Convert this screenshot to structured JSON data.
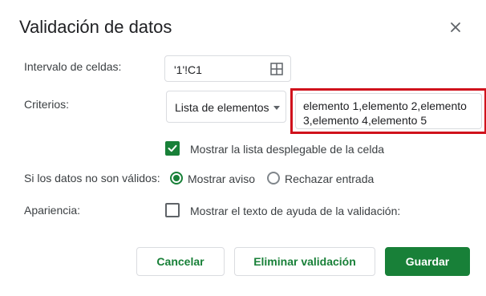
{
  "dialog": {
    "title": "Validación de datos",
    "close_icon": "close-icon"
  },
  "range": {
    "label": "Intervalo de celdas:",
    "value": "'1'!C1",
    "icon": "grid-icon"
  },
  "criteria": {
    "label": "Criterios:",
    "type_selected": "Lista de elementos",
    "items_value": "elemento 1,elemento 2,elemento 3,elemento 4,elemento 5",
    "highlight_color": "#d0121c"
  },
  "dropdown_option": {
    "checked": true,
    "label": "Mostrar la lista desplegable de la celda"
  },
  "invalid_data": {
    "label": "Si los datos no son válidos:",
    "option_warning": "Mostrar aviso",
    "option_reject": "Rechazar entrada",
    "selected": "Mostrar aviso"
  },
  "appearance": {
    "label": "Apariencia:",
    "checked": false,
    "help_text_label": "Mostrar el texto de ayuda de la validación:"
  },
  "buttons": {
    "cancel": "Cancelar",
    "remove": "Eliminar validación",
    "save": "Guardar"
  },
  "colors": {
    "accent": "#188038",
    "text": "#3c4043",
    "border": "#dadce0"
  }
}
